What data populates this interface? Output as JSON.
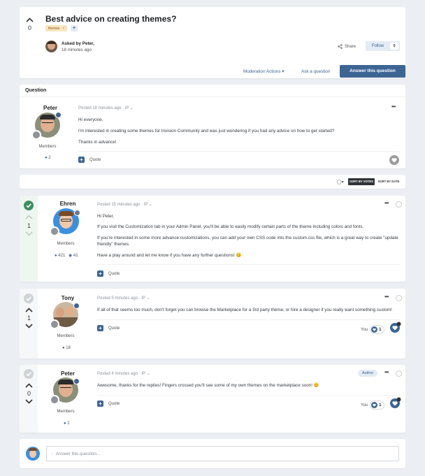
{
  "topic": {
    "vote_count": "0",
    "title": "Best advice on creating themes?",
    "tag": "themes",
    "tag_remove": "×",
    "tag_add": "+",
    "asked_by": "Asked by Peter,",
    "asked_time": "18 minutes ago",
    "share_label": "Share",
    "follow_label": "Follow",
    "follow_count": "0"
  },
  "actions": {
    "moderation": "Moderation Actions ▾",
    "ask": "Ask a question",
    "answer": "Answer this question"
  },
  "question_section": {
    "header": "Question",
    "author": "Peter",
    "role": "Members",
    "posts": "2",
    "posted": "Posted 18 minutes ago · IP ⌄",
    "lines": [
      "Hi everyone,",
      "I'm interested in creating some themes for Invision Community and was just wondering if you had any advice on how to get started?",
      "Thanks in advance!"
    ],
    "quote": "Quote"
  },
  "sort": {
    "by_votes": "SORT BY VOTES",
    "by_date": "SORT BY DATE"
  },
  "answers": [
    {
      "author": "Ehren",
      "role": "Members",
      "vote": "1",
      "posts": "421",
      "rep": "41",
      "posted": "Posted 15 minutes ago · IP ⌄",
      "lines": [
        "Hi Peter,",
        "If you visit the Customization tab in your Admin Panel, you'll be able to easily modify certain parts of the theme including colors and fonts.",
        "If you're interested in some more advance customizations, you can add your own CSS code into the custom.css file, which is a great way to create \"update",
        "friendly\" themes.",
        "Have a play around and let me know if you have any further questions! 😊"
      ],
      "quote": "Quote"
    },
    {
      "author": "Tony",
      "role": "Members",
      "vote": "1",
      "posts": "18",
      "posted": "Posted 5 minutes ago · IP ⌄",
      "lines": [
        "If all of that seems too much, don't forget you can browse the Marketplace for a 3rd party theme, or hire a designer if you really want something custom!"
      ],
      "quote": "Quote",
      "you_label": "You",
      "reaction_count": "1"
    },
    {
      "author": "Peter",
      "role": "Members",
      "vote": "0",
      "posts": "2",
      "posted": "Posted 4 minutes ago · IP ⌄",
      "author_badge": "Author",
      "lines": [
        "Awesome, thanks for the replies! Fingers crossed you'll see some of my own themes on the marketplace soon! 😊"
      ],
      "quote": "Quote",
      "you_label": "You",
      "reaction_count": "1"
    }
  ],
  "reply": {
    "placeholder": "Answer this question..."
  },
  "colors": {
    "accent": "#3d6594",
    "best_answer": "#3e8e5f",
    "tag_bg": "#f9e5c2"
  }
}
